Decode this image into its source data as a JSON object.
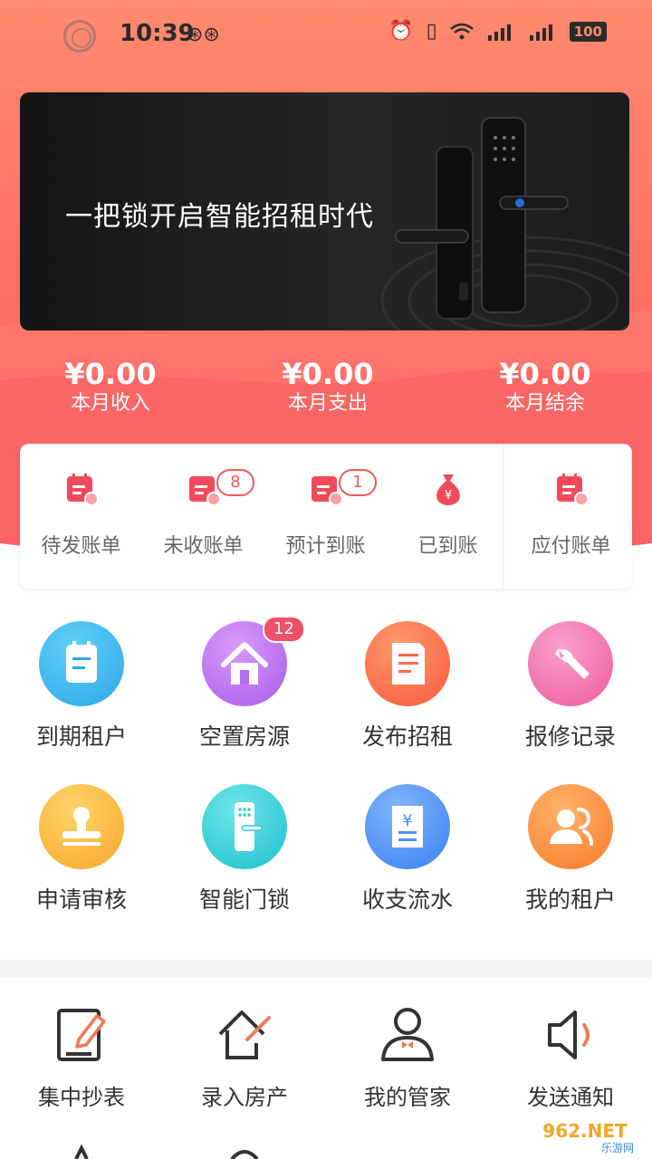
{
  "status_bar": {
    "time": "10:39",
    "battery": "100"
  },
  "banner": {
    "text": "一把锁开启智能招租时代"
  },
  "summary": [
    {
      "value": "¥0.00",
      "label": "本月收入"
    },
    {
      "value": "¥0.00",
      "label": "本月支出"
    },
    {
      "value": "¥0.00",
      "label": "本月结余"
    }
  ],
  "bills": [
    {
      "label": "待发账单",
      "icon": "bill-pending-icon"
    },
    {
      "label": "未收账单",
      "icon": "bill-unpaid-icon",
      "count": "8"
    },
    {
      "label": "预计到账",
      "icon": "bill-expected-icon",
      "count": "1"
    },
    {
      "label": "已到账",
      "icon": "money-bag-icon"
    },
    {
      "label": "应付账单",
      "icon": "bill-payable-icon"
    }
  ],
  "features": [
    {
      "label": "到期租户",
      "icon": "notepad-icon",
      "color": "#2ea7ea"
    },
    {
      "label": "空置房源",
      "icon": "house-icon",
      "color": "#b46ef0",
      "badge": "12"
    },
    {
      "label": "发布招租",
      "icon": "document-icon",
      "color": "#fb6a4a"
    },
    {
      "label": "报修记录",
      "icon": "wrench-icon",
      "color": "#f06aa8"
    },
    {
      "label": "申请审核",
      "icon": "stamp-icon",
      "color": "#fbb23c"
    },
    {
      "label": "智能门锁",
      "icon": "door-lock-icon",
      "color": "#2ccbd6"
    },
    {
      "label": "收支流水",
      "icon": "receipt-icon",
      "color": "#4a8ff5"
    },
    {
      "label": "我的租户",
      "icon": "tenants-icon",
      "color": "#fb8a3c"
    }
  ],
  "tools": [
    {
      "label": "集中抄表",
      "icon": "meter-reading-icon"
    },
    {
      "label": "录入房产",
      "icon": "add-property-icon"
    },
    {
      "label": "我的管家",
      "icon": "butler-icon"
    },
    {
      "label": "发送通知",
      "icon": "speaker-icon"
    }
  ],
  "watermark": {
    "text": "962.NET",
    "sub": "乐游网"
  }
}
